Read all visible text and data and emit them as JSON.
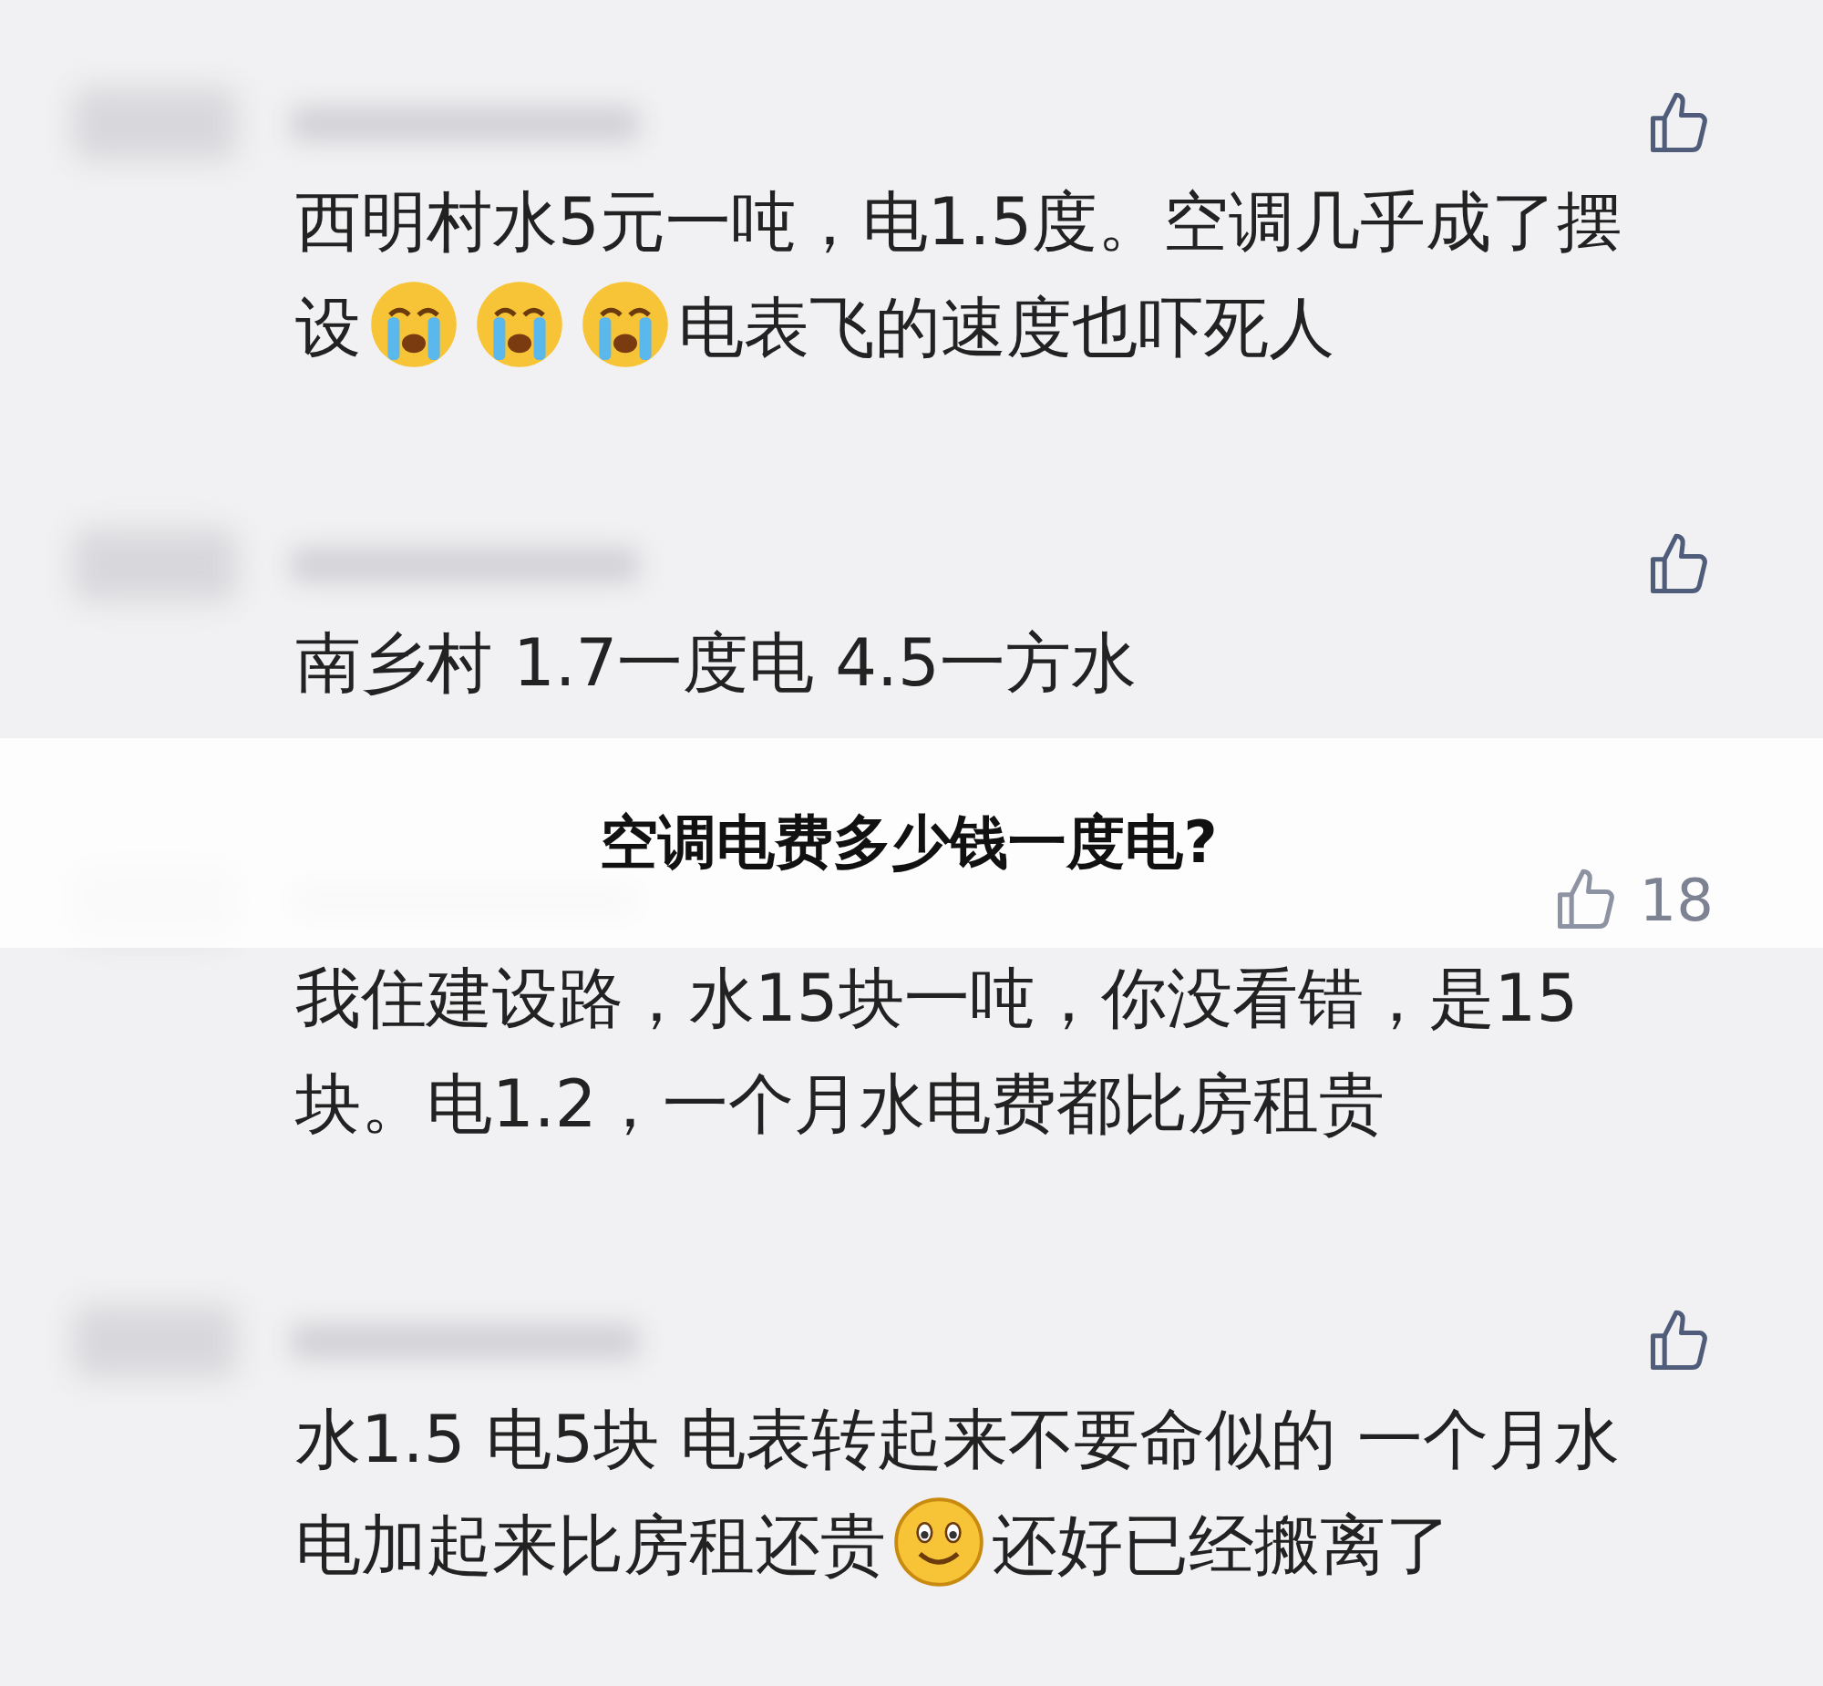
{
  "comments": [
    {
      "segments": [
        {
          "kind": "text",
          "text": "西明村水5元一吨，电1.5度。空调几乎成了摆设"
        },
        {
          "kind": "cry"
        },
        {
          "kind": "cry"
        },
        {
          "kind": "cry"
        },
        {
          "kind": "text",
          "text": "电表飞的速度也吓死人"
        }
      ]
    },
    {
      "segments": [
        {
          "kind": "text",
          "text": "南乡村  1.7一度电  4.5一方水"
        }
      ]
    },
    {
      "likes": "18",
      "segments": [
        {
          "kind": "text",
          "text": "我住建设路，水15块一吨，你没看错，是15块。电1.2，一个月水电费都比房租贵"
        }
      ]
    },
    {
      "segments": [
        {
          "kind": "text",
          "text": "水1.5   电5块  电表转起来不要命似的  一个月水电加起来比房租还贵"
        },
        {
          "kind": "smile"
        },
        {
          "kind": "text",
          "text": "还好已经搬离了"
        }
      ]
    }
  ],
  "banner": {
    "title": "空调电费多少钱一度电?"
  }
}
